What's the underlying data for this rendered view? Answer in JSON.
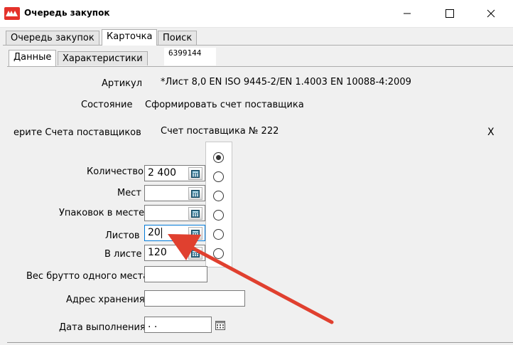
{
  "window": {
    "title": "Очередь закупок"
  },
  "tabs_main": [
    {
      "label": "Очередь закупок"
    },
    {
      "label": "Карточка"
    },
    {
      "label": "Поиск"
    }
  ],
  "tabs_sub": [
    {
      "label": "Данные"
    },
    {
      "label": "Характеристики"
    }
  ],
  "record_id": "6399144",
  "info": {
    "article_label": "Артикул",
    "article_value": "*Лист 8,0 EN ISO 9445-2/EN 1.4003 EN 10088-4:2009",
    "state_label": "Состояние",
    "state_value": "Сформировать счет поставщика",
    "supplier_label": "ерите Счета поставщиков",
    "supplier_value": "Счет поставщика № 222",
    "close_glyph": "X"
  },
  "fields": {
    "quantity": {
      "label": "Количество",
      "value": "2 400"
    },
    "places": {
      "label": "Мест",
      "value": ""
    },
    "packs": {
      "label": "Упаковок в месте",
      "value": ""
    },
    "sheets": {
      "label": "Листов",
      "value": "20"
    },
    "in_sheet": {
      "label": "В листе",
      "value": "120"
    },
    "gross_weight": {
      "label": "Вес брутто одного места",
      "value": ""
    },
    "storage": {
      "label": "Адрес хранения",
      "value": ""
    },
    "date": {
      "label": "Дата выполнения",
      "value": " .  ."
    }
  },
  "colors": {
    "accent_arrow": "#e0402f",
    "focus_border": "#0078d7",
    "app_icon": "#e4322b"
  },
  "icons": {
    "app": "app-logo-icon",
    "minimize": "minimize-icon",
    "maximize": "maximize-icon",
    "close": "close-icon",
    "calculator": "calculator-icon",
    "calendar": "calendar-icon"
  }
}
